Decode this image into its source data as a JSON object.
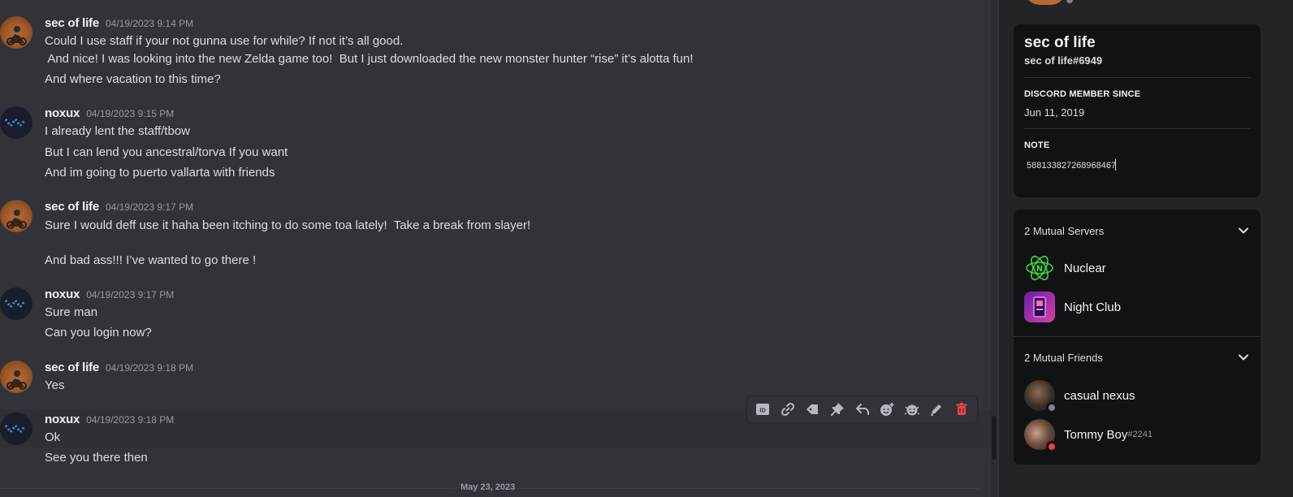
{
  "chat": {
    "messages": [
      {
        "author": "sec of life",
        "timestamp": "04/19/2023 9:14 PM",
        "lines": [
          "Could I use staff if your not gunna use for while? If not it’s all good.",
          " And nice! I was looking into the new Zelda game too!  But I just downloaded the new monster hunter “rise” it’s alotta fun!",
          "And where vacation to this time?"
        ]
      },
      {
        "author": "noxux",
        "timestamp": "04/19/2023 9:15 PM",
        "lines": [
          "I already lent the staff/tbow",
          "But I can lend you ancestral/torva If you want",
          "And im going to puerto vallarta with friends"
        ]
      },
      {
        "author": "sec of life",
        "timestamp": "04/19/2023 9:17 PM",
        "lines": [
          "Sure I would deff use it haha been itching to do some toa lately!  Take a break from slayer!",
          "And bad ass!!! I’ve wanted to go there !"
        ]
      },
      {
        "author": "noxux",
        "timestamp": "04/19/2023 9:17 PM",
        "lines": [
          "Sure man",
          "Can you login now?"
        ]
      },
      {
        "author": "sec of life",
        "timestamp": "04/19/2023 9:18 PM",
        "lines": [
          "Yes"
        ]
      },
      {
        "author": "noxux",
        "timestamp": "04/19/2023 9:18 PM",
        "lines": [
          "Ok",
          "See you there then"
        ]
      }
    ],
    "date_divider": "May 23, 2023",
    "toolbar_icons": [
      "id-icon",
      "link-icon",
      "tag-icon",
      "pin-icon",
      "reply-icon",
      "add-reaction-icon",
      "super-reaction-icon",
      "edit-icon",
      "delete-icon"
    ]
  },
  "profile": {
    "display_name": "sec of life",
    "tag": "sec of life#6949",
    "member_since_title": "DISCORD MEMBER SINCE",
    "member_since": "Jun 11, 2019",
    "note_title": "NOTE",
    "note_value": "588133827268968467"
  },
  "mutual": {
    "servers_label": "2 Mutual Servers",
    "servers": [
      {
        "name": "Nuclear",
        "icon": "nuclear-server-icon"
      },
      {
        "name": "Night Club",
        "icon": "nightclub-server-icon"
      }
    ],
    "friends_label": "2 Mutual Friends",
    "friends": [
      {
        "name": "casual nexus",
        "discriminator": "",
        "status": "offline"
      },
      {
        "name": "Tommy Boy",
        "discriminator": "#2241",
        "status": "dnd"
      }
    ]
  },
  "colors": {
    "chat_bg": "#313338",
    "panel_bg": "#232428",
    "card_bg": "#111214",
    "delete": "#f23f43",
    "offline": "#80848e",
    "dnd": "#f23f43"
  }
}
